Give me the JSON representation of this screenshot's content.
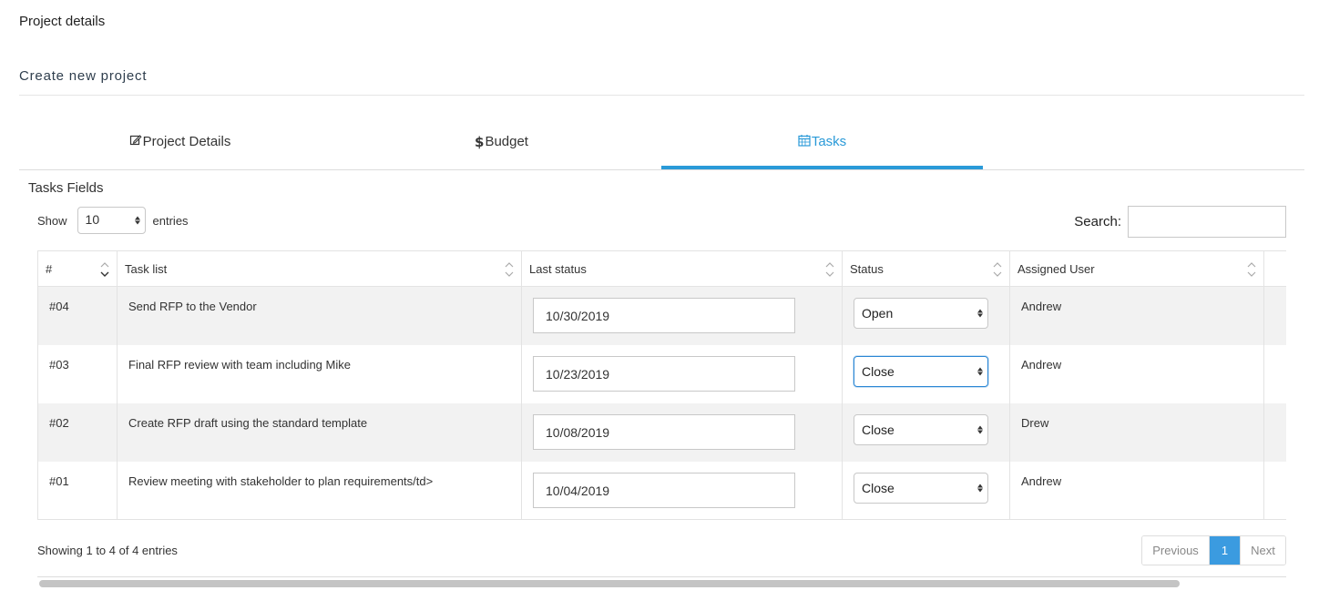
{
  "page": {
    "heading": "Project details",
    "section_title": "Create new project"
  },
  "tabs": [
    {
      "label": "Project Details",
      "icon": "edit-icon"
    },
    {
      "label": "Budget",
      "icon": "dollar-icon",
      "icon_text": "$"
    },
    {
      "label": "Tasks",
      "icon": "calendar-icon",
      "active": true
    }
  ],
  "fields_title": "Tasks Fields",
  "length": {
    "show_label": "Show",
    "value": "10",
    "entries_label": "entries"
  },
  "search": {
    "label": "Search:",
    "value": ""
  },
  "table": {
    "columns": [
      "#",
      "Task list",
      "Last status",
      "Status",
      "Assigned User"
    ],
    "rows": [
      {
        "num": "#04",
        "task": "Send RFP to the Vendor",
        "date": "10/30/2019",
        "status": "Open",
        "user": "Andrew"
      },
      {
        "num": "#03",
        "task": "Final RFP review with team including Mike",
        "date": "10/23/2019",
        "status": "Close",
        "user": "Andrew"
      },
      {
        "num": "#02",
        "task": "Create RFP draft using the standard template",
        "date": "10/08/2019",
        "status": "Close",
        "user": "Drew"
      },
      {
        "num": "#01",
        "task": "Review meeting with stakeholder to plan requirements/td>",
        "date": "10/04/2019",
        "status": "Close",
        "user": "Andrew"
      }
    ]
  },
  "info": "Showing 1 to 4 of 4 entries",
  "pagination": {
    "previous": "Previous",
    "current": "1",
    "next": "Next"
  },
  "colors": {
    "accent": "#2a9ad8",
    "page_active": "#3b9be0",
    "row_stripe": "#f2f2f2"
  }
}
